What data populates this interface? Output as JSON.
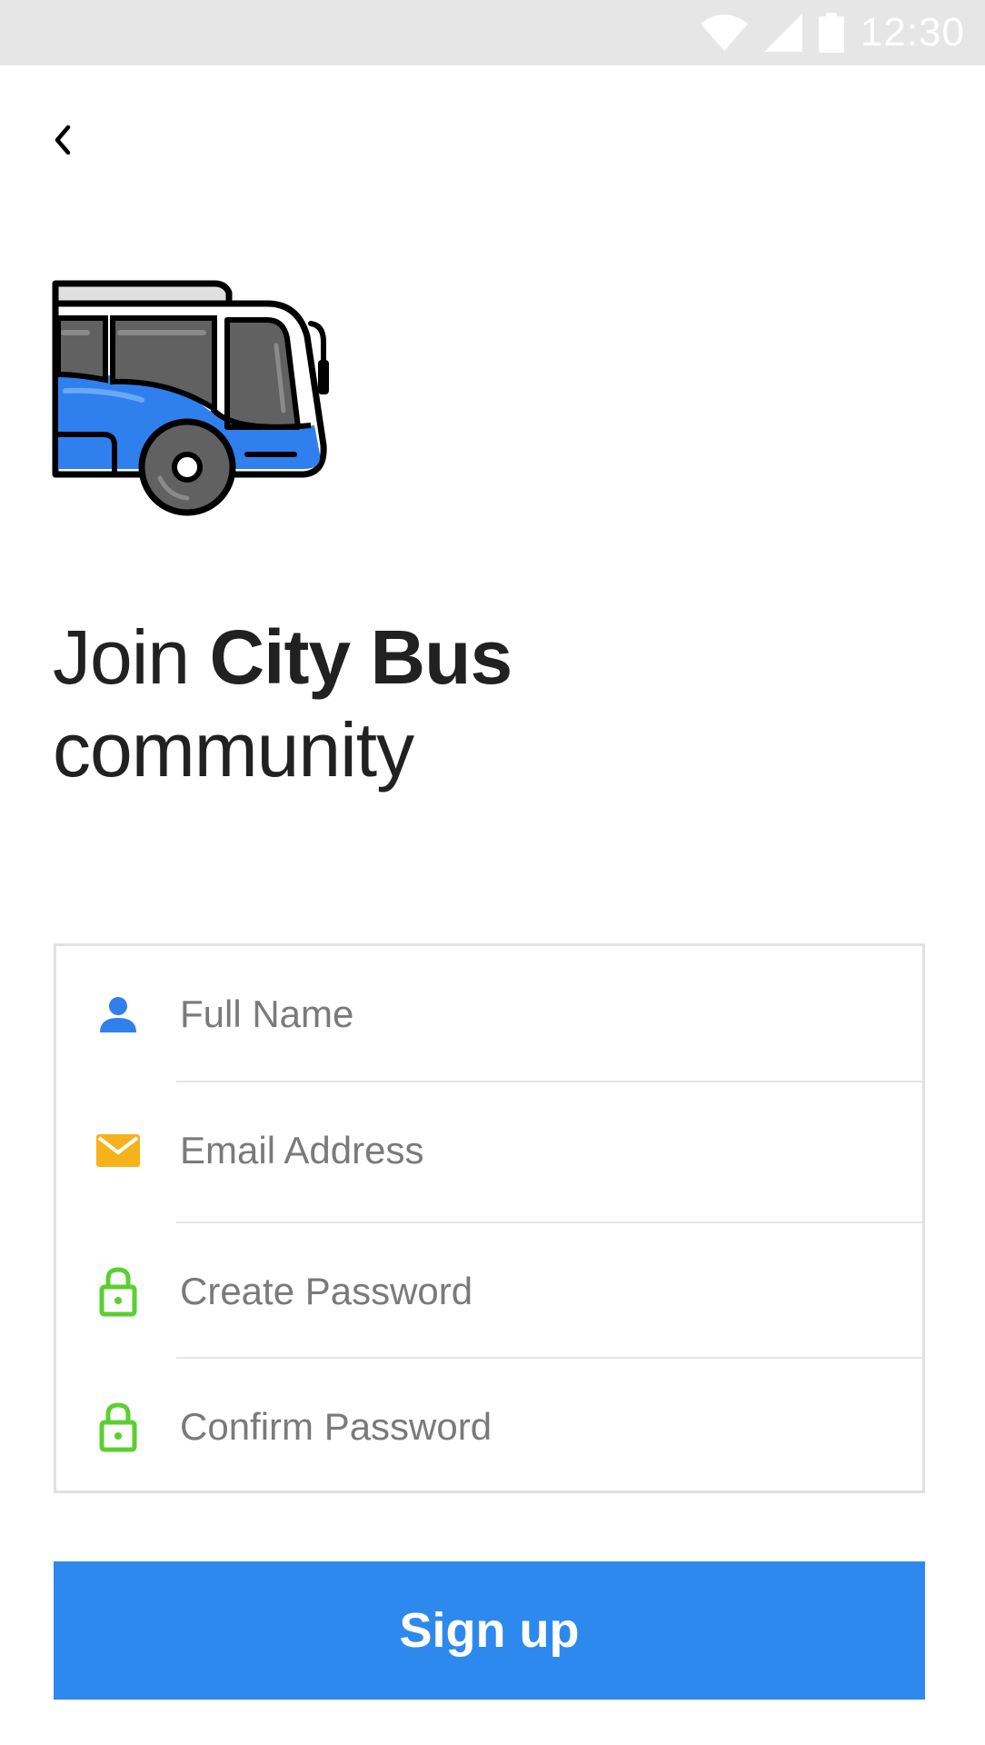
{
  "status_bar": {
    "time": "12:30",
    "icons": [
      "wifi-icon",
      "cell-signal-icon",
      "battery-icon"
    ]
  },
  "header": {
    "back_icon": "chevron-left-icon"
  },
  "logo": {
    "icon": "bus-icon",
    "colors": {
      "body": "#2f80ed",
      "window": "#616161",
      "outline": "#000000",
      "roof": "#e0e0e0"
    }
  },
  "headline": {
    "prefix": "Join ",
    "brand": "City Bus",
    "suffix": "community"
  },
  "form": {
    "fields": [
      {
        "name": "full-name",
        "placeholder": "Full Name",
        "value": "",
        "icon": "person-icon",
        "icon_color": "#2f80ed"
      },
      {
        "name": "email-address",
        "placeholder": "Email Address",
        "value": "",
        "icon": "envelope-icon",
        "icon_color": "#f6b21a"
      },
      {
        "name": "create-password",
        "placeholder": "Create Password",
        "value": "",
        "icon": "lock-icon",
        "icon_color": "#5bcf30"
      },
      {
        "name": "confirm-password",
        "placeholder": "Confirm Password",
        "value": "",
        "icon": "lock-icon",
        "icon_color": "#5bcf30"
      }
    ]
  },
  "signup_button": {
    "label": "Sign up",
    "color": "#2e89ee"
  }
}
